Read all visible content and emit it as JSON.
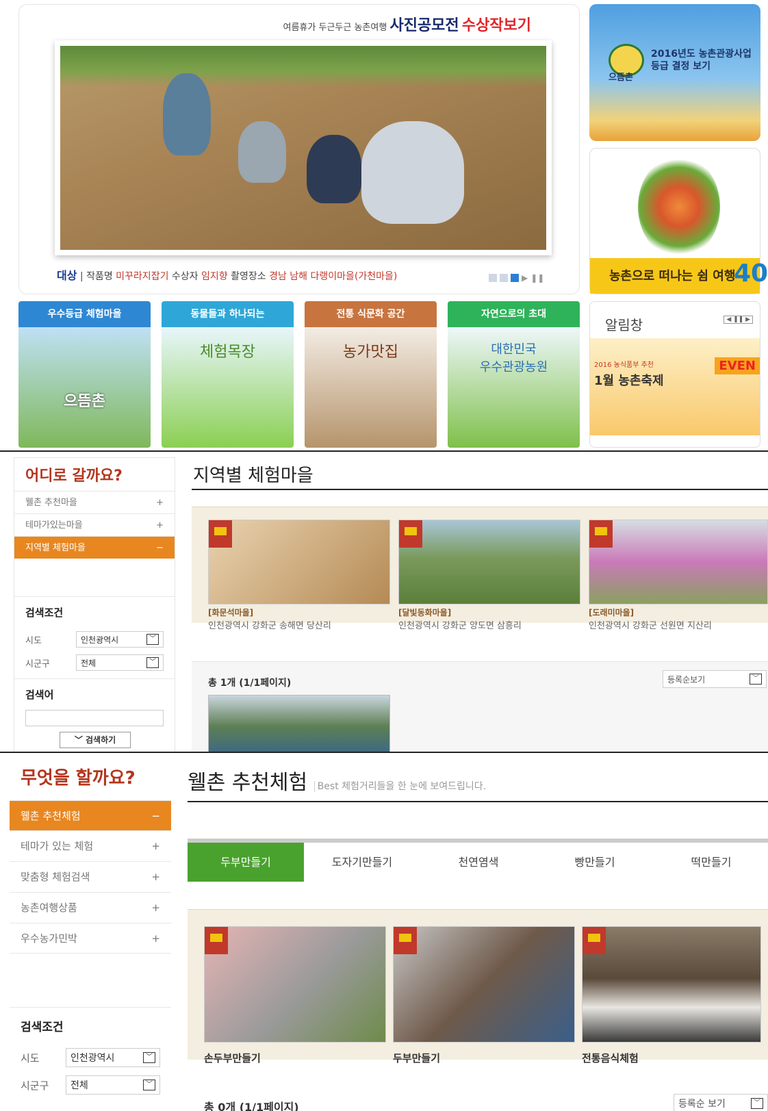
{
  "section1": {
    "hero": {
      "small": "여름휴가 두근두근 농촌여행",
      "title": "사진공모전",
      "title_red": "수상작보기",
      "award": "대상",
      "sep": "|",
      "work_label": "작품명",
      "work": "미꾸라지잡기",
      "winner_label": "수상자",
      "winner": "임지향",
      "place_label": "촬영장소",
      "place": "경남 남해 다랭이마을(가천마을)"
    },
    "side1": {
      "brand": "으뜸촌",
      "line1": "2016년도 농촌관광사업",
      "line2": "등급 결정 보기"
    },
    "side2": {
      "text": "농촌으로 떠나는 쉼 여행",
      "num": "40"
    },
    "cards": [
      {
        "head": "우수등급 체험마을",
        "color": "#2e87d3",
        "body": "으뜸촌"
      },
      {
        "head": "동물들과 하나되는",
        "color": "#2ea7d8",
        "body": "체험목장"
      },
      {
        "head": "전통 식문화 공간",
        "color": "#c8743f",
        "body": "농가맛집"
      },
      {
        "head": "자연으로의 초대",
        "color": "#2eb35a",
        "body": "대한민국\n우수관광농원"
      }
    ],
    "alarm": {
      "title": "알림창",
      "sub": "2016 농식품부 추천",
      "main": "1월 농촌축제",
      "event": "EVEN"
    }
  },
  "section2": {
    "nav_title": "어디로 갈까요?",
    "items": [
      {
        "label": "웰촌 추천마을",
        "sign": "+"
      },
      {
        "label": "테마가있는마을",
        "sign": "+"
      },
      {
        "label": "지역별 체험마을",
        "sign": "−"
      }
    ],
    "search_title": "검색조건",
    "sido_label": "시도",
    "sido_value": "인천광역시",
    "sigungu_label": "시군구",
    "sigungu_value": "전체",
    "keyword_title": "검색어",
    "search_button": "검색하기",
    "page_title": "지역별 체험마을",
    "featured": [
      {
        "name": "[화문석마을]",
        "addr": "인천광역시 강화군 송해면 당산리"
      },
      {
        "name": "[달빛동화마을]",
        "addr": "인천광역시 강화군 양도면 삼흥리"
      },
      {
        "name": "[도래미마을]",
        "addr": "인천광역시 강화군 선원면 지산리"
      }
    ],
    "total": "총 1개 (1/1페이지)",
    "sort": "등록순보기"
  },
  "section3": {
    "nav_title": "무엇을 할까요?",
    "items": [
      {
        "label": "웰촌 추천체험",
        "sign": "−"
      },
      {
        "label": "테마가 있는 체험",
        "sign": "+"
      },
      {
        "label": "맞춤형 체험검색",
        "sign": "+"
      },
      {
        "label": "농촌여행상품",
        "sign": "+"
      },
      {
        "label": "우수농가민박",
        "sign": "+"
      }
    ],
    "search_title": "검색조건",
    "sido_label": "시도",
    "sido_value": "인천광역시",
    "sigungu_label": "시군구",
    "sigungu_value": "전체",
    "page_title": "웰촌 추천체험",
    "page_sub": "Best 체험거리들을 한 눈에 보여드립니다.",
    "tabs": [
      "두부만들기",
      "도자기만들기",
      "천연염색",
      "빵만들기",
      "떡만들기"
    ],
    "featured": [
      "손두부만들기",
      "두부만들기",
      "전통음식체험"
    ],
    "total": "총 0개 (1/1페이지)",
    "sort": "등록순 보기"
  }
}
